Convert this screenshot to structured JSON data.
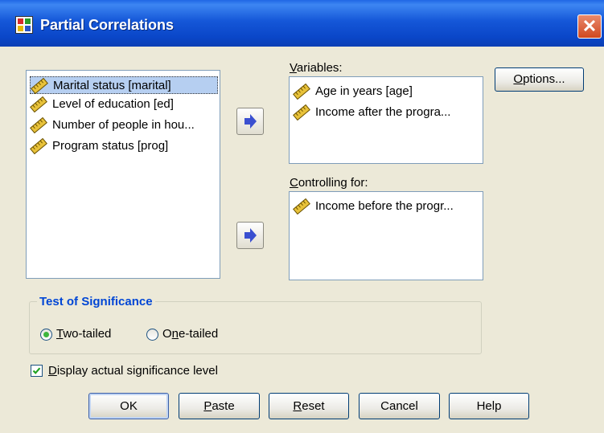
{
  "window": {
    "title": "Partial Correlations",
    "close_glyph": "✕"
  },
  "source_list": {
    "items": [
      {
        "label": "Marital status [marital]",
        "selected": true
      },
      {
        "label": "Level of education [ed]",
        "selected": false
      },
      {
        "label": "Number of people in hou...",
        "selected": false
      },
      {
        "label": "Program status [prog]",
        "selected": false
      }
    ]
  },
  "variables": {
    "label_pre": "",
    "label_key": "V",
    "label_post": "ariables:",
    "items": [
      {
        "label": "Age in years [age]"
      },
      {
        "label": "Income after the progra..."
      }
    ]
  },
  "controlling": {
    "label_pre": "",
    "label_key": "C",
    "label_post": "ontrolling for:",
    "items": [
      {
        "label": "Income before the progr..."
      }
    ]
  },
  "options_button": {
    "pre": "",
    "key": "O",
    "post": "ptions..."
  },
  "significance": {
    "title": "Test of Significance",
    "two_tailed": {
      "pre": "",
      "key": "T",
      "post": "wo-tailed",
      "checked": true
    },
    "one_tailed": {
      "pre": "O",
      "key": "n",
      "post": "e-tailed",
      "checked": false
    }
  },
  "display_level": {
    "pre": "",
    "key": "D",
    "post": "isplay actual significance level",
    "checked": true
  },
  "buttons": {
    "ok": "OK",
    "paste": {
      "pre": "",
      "key": "P",
      "post": "aste"
    },
    "reset": {
      "pre": "",
      "key": "R",
      "post": "eset"
    },
    "cancel": "Cancel",
    "help": "Help"
  },
  "colors": {
    "accent": "#0046d5",
    "title_bar": "#0a46c8",
    "selection": "#b6cff1",
    "arrow": "#3a4fd0"
  },
  "icons": {
    "scale_var": "ruler-icon",
    "move_arrow": "right-arrow-icon"
  }
}
